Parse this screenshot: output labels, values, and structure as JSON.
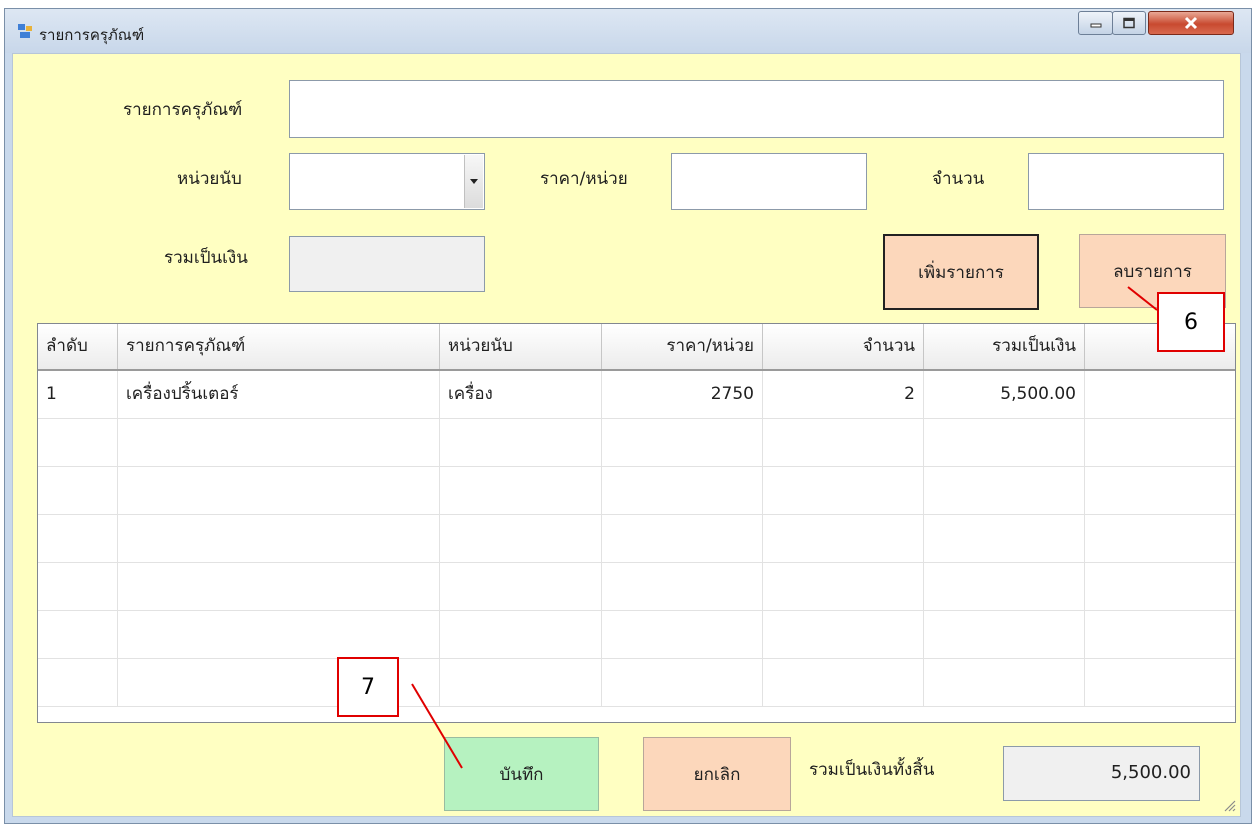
{
  "window": {
    "title": "รายการครุภัณฑ์"
  },
  "form": {
    "item_label": "รายการครุภัณฑ์",
    "item_value": "",
    "unit_label": "หน่วยนับ",
    "unit_value": "",
    "price_label": "ราคา/หน่วย",
    "price_value": "",
    "qty_label": "จำนวน",
    "qty_value": "",
    "subtotal_label": "รวมเป็นเงิน",
    "subtotal_value": ""
  },
  "buttons": {
    "add": "เพิ่มรายการ",
    "delete": "ลบรายการ",
    "save": "บันทึก",
    "cancel": "ยกเลิก"
  },
  "table": {
    "columns": [
      "ลำดับ",
      "รายการครุภัณฑ์",
      "หน่วยนับ",
      "ราคา/หน่วย",
      "จำนวน",
      "รวมเป็นเงิน",
      ""
    ],
    "rows": [
      [
        "1",
        "เครื่องปริ้นเตอร์",
        "เครื่อง",
        "2750",
        "2",
        "5,500.00",
        ""
      ],
      [
        "",
        "",
        "",
        "",
        "",
        "",
        ""
      ],
      [
        "",
        "",
        "",
        "",
        "",
        "",
        ""
      ],
      [
        "",
        "",
        "",
        "",
        "",
        "",
        ""
      ],
      [
        "",
        "",
        "",
        "",
        "",
        "",
        ""
      ],
      [
        "",
        "",
        "",
        "",
        "",
        "",
        ""
      ],
      [
        "",
        "",
        "",
        "",
        "",
        "",
        ""
      ]
    ]
  },
  "footer": {
    "grand_total_label": "รวมเป็นเงินทั้งสิ้น",
    "grand_total_value": "5,500.00"
  },
  "annotations": {
    "callout_delete": "6",
    "callout_save": "7",
    "color": "#e00000"
  },
  "icons": {
    "app": "form-app-icon",
    "minimize": "minimize-icon",
    "maximize": "maximize-icon",
    "close": "close-icon",
    "dropdown": "chevron-down-icon",
    "resize": "resize-grip-icon"
  }
}
